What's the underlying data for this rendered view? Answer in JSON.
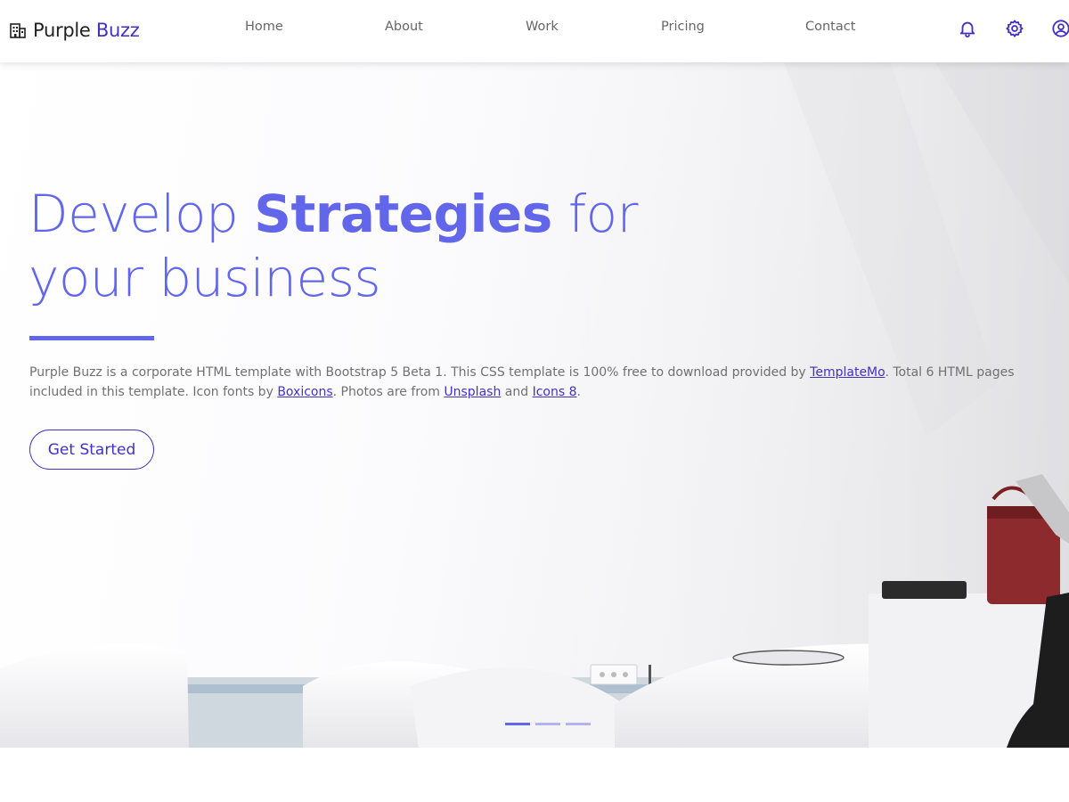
{
  "brand": {
    "name_main": "Purple",
    "name_accent": "Buzz",
    "icon": "building-icon"
  },
  "nav": {
    "links": [
      "Home",
      "About",
      "Work",
      "Pricing",
      "Contact"
    ],
    "icons": [
      "bell-icon",
      "gear-icon",
      "user-circle-icon"
    ]
  },
  "hero": {
    "title_part1": "Develop",
    "title_strong": "Strategies",
    "title_part2": "for",
    "title_line2": "your business",
    "desc_1": "Purple Buzz is a corporate HTML template with Bootstrap 5 Beta 1. This CSS template is 100% free to download provided by",
    "link_templatemo": "TemplateMo",
    "desc_2": ". Total 6 HTML pages included in this template. Icon fonts by",
    "link_boxicons": "Boxicons",
    "desc_3": ". Photos are from",
    "link_unsplash": "Unsplash",
    "desc_4": "and",
    "link_icons8": "Icons 8",
    "desc_5": ".",
    "cta": "Get Started"
  },
  "carousel": {
    "slides": 3,
    "active_index": 0
  },
  "colors": {
    "accent": "#6266ea",
    "brand": "#4232c2",
    "text_muted": "#707070"
  }
}
